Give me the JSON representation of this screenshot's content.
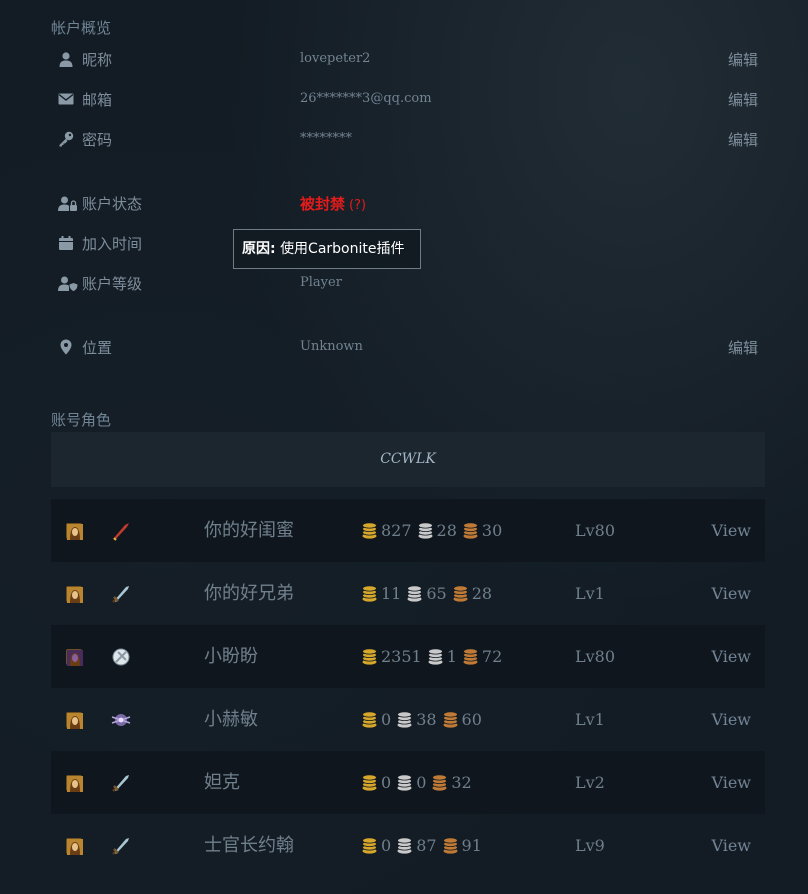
{
  "overview": {
    "title": "帐户概览",
    "edit_label": "编辑",
    "nickname": {
      "label": "昵称",
      "value": "lovepeter2"
    },
    "email": {
      "label": "邮箱",
      "value": "26*******3@qq.com"
    },
    "password": {
      "label": "密码",
      "value": "********"
    },
    "status": {
      "label": "账户状态",
      "value": "被封禁",
      "help": "(?)"
    },
    "joined": {
      "label": "加入时间"
    },
    "tooltip": {
      "reason_label": "原因:",
      "reason": "使用Carbonite插件"
    },
    "level": {
      "label": "账户等级",
      "value": "Player"
    },
    "location": {
      "label": "位置",
      "value": "Unknown"
    }
  },
  "characters": {
    "title": "账号角色",
    "realm": "CCWLK",
    "view_label": "View",
    "rows": [
      {
        "race_icon": "human-female-portrait-icon",
        "class_icon": "rogue-dagger-icon",
        "name": "你的好闺蜜",
        "gold": "827",
        "silver": "28",
        "copper": "30",
        "level": "Lv80"
      },
      {
        "race_icon": "human-female-portrait-icon",
        "class_icon": "warrior-sword-icon",
        "name": "你的好兄弟",
        "gold": "11",
        "silver": "65",
        "copper": "28",
        "level": "Lv1"
      },
      {
        "race_icon": "undead-female-portrait-icon",
        "class_icon": "priest-icon",
        "name": "小盼盼",
        "gold": "2351",
        "silver": "1",
        "copper": "72",
        "level": "Lv80"
      },
      {
        "race_icon": "human-female-portrait-icon",
        "class_icon": "mage-icon",
        "name": "小赫敏",
        "gold": "0",
        "silver": "38",
        "copper": "60",
        "level": "Lv1"
      },
      {
        "race_icon": "human-female-portrait-icon",
        "class_icon": "warrior-sword-icon",
        "name": "妲克",
        "gold": "0",
        "silver": "0",
        "copper": "32",
        "level": "Lv2"
      },
      {
        "race_icon": "human-female-portrait-icon",
        "class_icon": "warrior-sword-icon",
        "name": "士官长约翰",
        "gold": "0",
        "silver": "87",
        "copper": "91",
        "level": "Lv9"
      }
    ]
  },
  "colors": {
    "background": "#131c24",
    "banned": "#e21b1b",
    "gold": "#d6a72a",
    "silver": "#c9c9c9",
    "copper": "#c07a35"
  }
}
